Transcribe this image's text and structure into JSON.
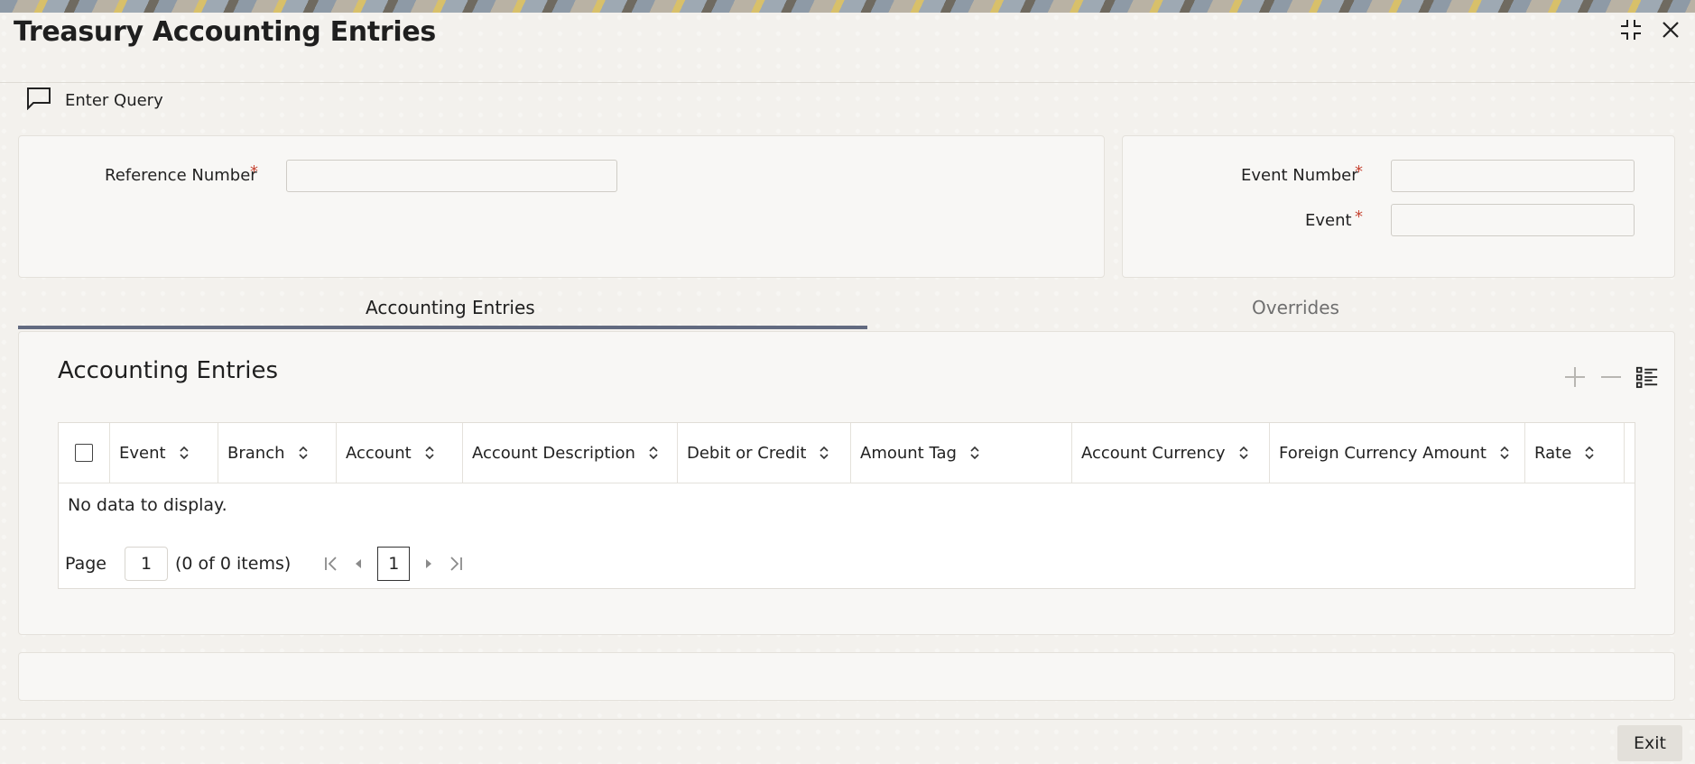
{
  "window": {
    "title": "Treasury Accounting Entries",
    "icons": [
      "collapse-icon",
      "close-icon"
    ]
  },
  "toolbar": {
    "enter_query_label": "Enter Query",
    "enter_query_icon": "speech-bubble-icon"
  },
  "header_form": {
    "reference_number": {
      "label": "Reference Number",
      "required_mark": "*",
      "value": ""
    },
    "event_number": {
      "label": "Event Number",
      "required_mark": "*",
      "value": ""
    },
    "event": {
      "label": "Event",
      "required_mark": "*",
      "value": ""
    }
  },
  "tabs": [
    {
      "label": "Accounting Entries",
      "active": true
    },
    {
      "label": "Overrides",
      "active": false
    }
  ],
  "accounting_entries": {
    "section_title": "Accounting Entries",
    "tools": [
      "add-row-icon",
      "delete-row-icon",
      "column-list-icon"
    ],
    "columns": [
      "Event",
      "Branch",
      "Account",
      "Account Description",
      "Debit or Credit",
      "Amount Tag",
      "Account Currency",
      "Foreign Currency Amount",
      "Rate"
    ],
    "rows": [],
    "empty_message": "No data to display.",
    "pagination": {
      "page_label": "Page",
      "page_input": "1",
      "items_summary": "(0 of 0 items)",
      "current_page": "1"
    }
  },
  "footer": {
    "exit_label": "Exit"
  },
  "colors": {
    "required": "#c74634",
    "active_tab_bar": "#626a80",
    "inactive_tab_text": "#6f6f6f"
  }
}
